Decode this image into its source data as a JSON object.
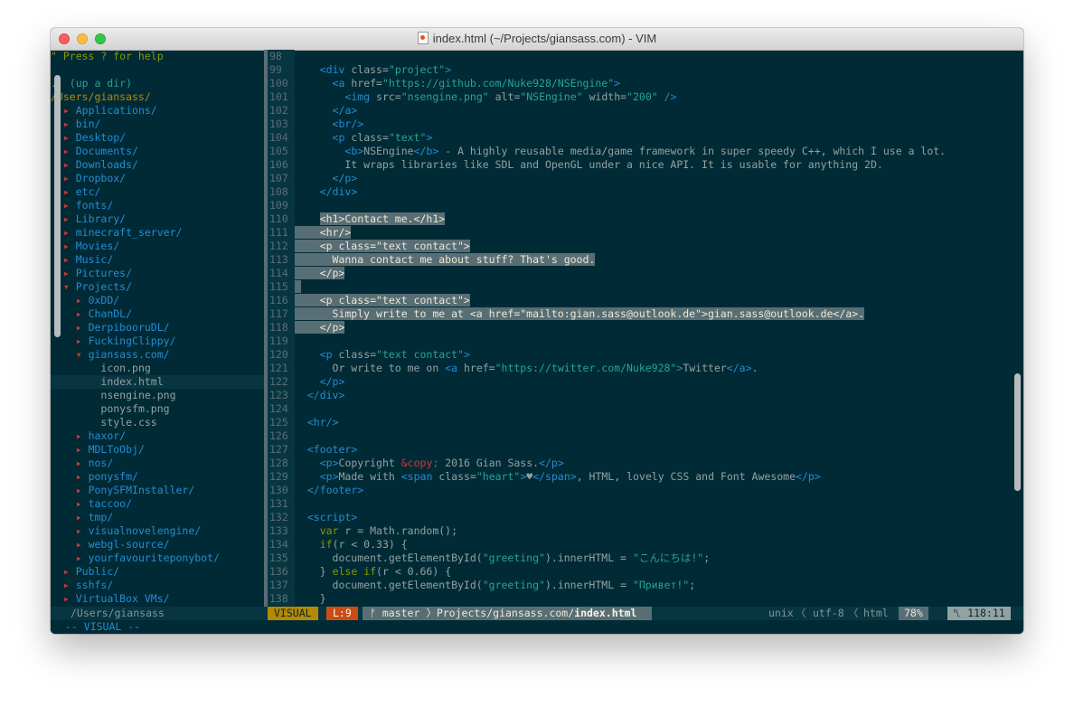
{
  "window": {
    "title": "index.html (~/Projects/giansass.com) - VIM"
  },
  "tree": {
    "help": "\" Press ? for help",
    "up": ".. (up a dir)",
    "root": "/Users/giansass/",
    "items": [
      {
        "depth": 0,
        "type": "dir",
        "open": false,
        "name": "Applications/"
      },
      {
        "depth": 0,
        "type": "dir",
        "open": false,
        "name": "bin/"
      },
      {
        "depth": 0,
        "type": "dir",
        "open": false,
        "name": "Desktop/"
      },
      {
        "depth": 0,
        "type": "dir",
        "open": false,
        "name": "Documents/"
      },
      {
        "depth": 0,
        "type": "dir",
        "open": false,
        "name": "Downloads/"
      },
      {
        "depth": 0,
        "type": "dir",
        "open": false,
        "name": "Dropbox/"
      },
      {
        "depth": 0,
        "type": "dir",
        "open": false,
        "name": "etc/"
      },
      {
        "depth": 0,
        "type": "dir",
        "open": false,
        "name": "fonts/"
      },
      {
        "depth": 0,
        "type": "dir",
        "open": false,
        "name": "Library/"
      },
      {
        "depth": 0,
        "type": "dir",
        "open": false,
        "name": "minecraft_server/"
      },
      {
        "depth": 0,
        "type": "dir",
        "open": false,
        "name": "Movies/"
      },
      {
        "depth": 0,
        "type": "dir",
        "open": false,
        "name": "Music/"
      },
      {
        "depth": 0,
        "type": "dir",
        "open": false,
        "name": "Pictures/"
      },
      {
        "depth": 0,
        "type": "dir",
        "open": true,
        "name": "Projects/"
      },
      {
        "depth": 1,
        "type": "dir",
        "open": false,
        "name": "0xDD/"
      },
      {
        "depth": 1,
        "type": "dir",
        "open": false,
        "name": "ChanDL/"
      },
      {
        "depth": 1,
        "type": "dir",
        "open": false,
        "name": "DerpibooruDL/"
      },
      {
        "depth": 1,
        "type": "dir",
        "open": false,
        "name": "FuckingClippy/"
      },
      {
        "depth": 1,
        "type": "dir",
        "open": true,
        "name": "giansass.com/"
      },
      {
        "depth": 2,
        "type": "file",
        "name": "icon.png"
      },
      {
        "depth": 2,
        "type": "file",
        "name": "index.html",
        "selected": true
      },
      {
        "depth": 2,
        "type": "file",
        "name": "nsengine.png"
      },
      {
        "depth": 2,
        "type": "file",
        "name": "ponysfm.png"
      },
      {
        "depth": 2,
        "type": "file",
        "name": "style.css"
      },
      {
        "depth": 1,
        "type": "dir",
        "open": false,
        "name": "haxor/"
      },
      {
        "depth": 1,
        "type": "dir",
        "open": false,
        "name": "MDLToObj/"
      },
      {
        "depth": 1,
        "type": "dir",
        "open": false,
        "name": "nos/"
      },
      {
        "depth": 1,
        "type": "dir",
        "open": false,
        "name": "ponysfm/"
      },
      {
        "depth": 1,
        "type": "dir",
        "open": false,
        "name": "PonySFMInstaller/"
      },
      {
        "depth": 1,
        "type": "dir",
        "open": false,
        "name": "taccoo/"
      },
      {
        "depth": 1,
        "type": "dir",
        "open": false,
        "name": "tmp/"
      },
      {
        "depth": 1,
        "type": "dir",
        "open": false,
        "name": "visualnovelengine/"
      },
      {
        "depth": 1,
        "type": "dir",
        "open": false,
        "name": "webgl-source/"
      },
      {
        "depth": 1,
        "type": "dir",
        "open": false,
        "name": "yourfavouriteponybot/"
      },
      {
        "depth": 0,
        "type": "dir",
        "open": false,
        "name": "Public/"
      },
      {
        "depth": 0,
        "type": "dir",
        "open": false,
        "name": "sshfs/"
      },
      {
        "depth": 0,
        "type": "dir",
        "open": false,
        "name": "VirtualBox VMs/"
      }
    ]
  },
  "editor": {
    "lines": [
      {
        "n": "98",
        "sel": false,
        "t": ""
      },
      {
        "n": "99",
        "sel": false,
        "t": "    <div class=\"project\">"
      },
      {
        "n": "100",
        "sel": false,
        "t": "      <a href=\"https://github.com/Nuke928/NSEngine\">"
      },
      {
        "n": "101",
        "sel": false,
        "t": "        <img src=\"nsengine.png\" alt=\"NSEngine\" width=\"200\" />"
      },
      {
        "n": "102",
        "sel": false,
        "t": "      </a>"
      },
      {
        "n": "103",
        "sel": false,
        "t": "      <br/>"
      },
      {
        "n": "104",
        "sel": false,
        "t": "      <p class=\"text\">"
      },
      {
        "n": "105",
        "sel": false,
        "t": "        <b>NSEngine</b> - A highly reusable media/game framework in super speedy C++, which I use a lot."
      },
      {
        "n": "106",
        "sel": false,
        "t": "        It wraps libraries like SDL and OpenGL under a nice API. It is usable for anything 2D."
      },
      {
        "n": "107",
        "sel": false,
        "t": "      </p>"
      },
      {
        "n": "108",
        "sel": false,
        "t": "    </div>"
      },
      {
        "n": "109",
        "sel": false,
        "t": ""
      },
      {
        "n": "110",
        "sel": true,
        "pre": "    ",
        "t": "<h1>Contact me.</h1>"
      },
      {
        "n": "111",
        "sel": true,
        "pre": "",
        "t": "    <hr/>"
      },
      {
        "n": "112",
        "sel": true,
        "pre": "",
        "t": "    <p class=\"text contact\">"
      },
      {
        "n": "113",
        "sel": true,
        "pre": "",
        "t": "      Wanna contact me about stuff? That's good."
      },
      {
        "n": "114",
        "sel": true,
        "pre": "",
        "t": "    </p>"
      },
      {
        "n": "115",
        "sel": true,
        "pre": "",
        "t": " "
      },
      {
        "n": "116",
        "sel": true,
        "pre": "",
        "t": "    <p class=\"text contact\">"
      },
      {
        "n": "117",
        "sel": true,
        "pre": "",
        "t": "      Simply write to me at <a href=\"mailto:gian.sass@outlook.de\">gian.sass@outlook.de</a>."
      },
      {
        "n": "118",
        "sel": true,
        "pre": "",
        "t": "    </p>"
      },
      {
        "n": "119",
        "sel": false,
        "t": ""
      },
      {
        "n": "120",
        "sel": false,
        "t": "    <p class=\"text contact\">"
      },
      {
        "n": "121",
        "sel": false,
        "t": "      Or write to me on <a href=\"https://twitter.com/Nuke928\">Twitter</a>."
      },
      {
        "n": "122",
        "sel": false,
        "t": "    </p>"
      },
      {
        "n": "123",
        "sel": false,
        "t": "  </div>"
      },
      {
        "n": "124",
        "sel": false,
        "t": ""
      },
      {
        "n": "125",
        "sel": false,
        "t": "  <hr/>"
      },
      {
        "n": "126",
        "sel": false,
        "t": ""
      },
      {
        "n": "127",
        "sel": false,
        "t": "  <footer>"
      },
      {
        "n": "128",
        "sel": false,
        "t": "    <p>Copyright &copy; 2016 Gian Sass.</p>"
      },
      {
        "n": "129",
        "sel": false,
        "t": "    <p>Made with <span class=\"heart\">♥</span>, HTML, lovely CSS and Font Awesome</p>"
      },
      {
        "n": "130",
        "sel": false,
        "t": "  </footer>"
      },
      {
        "n": "131",
        "sel": false,
        "t": ""
      },
      {
        "n": "132",
        "sel": false,
        "t": "  <script>"
      },
      {
        "n": "133",
        "sel": false,
        "t": "    var r = Math.random();"
      },
      {
        "n": "134",
        "sel": false,
        "t": "    if(r < 0.33) {"
      },
      {
        "n": "135",
        "sel": false,
        "t": "      document.getElementById(\"greeting\").innerHTML = \"こんにちは!\";"
      },
      {
        "n": "136",
        "sel": false,
        "t": "    } else if(r < 0.66) {"
      },
      {
        "n": "137",
        "sel": false,
        "t": "      document.getElementById(\"greeting\").innerHTML = \"Привет!\";"
      },
      {
        "n": "138",
        "sel": false,
        "t": "    }"
      }
    ]
  },
  "status": {
    "tree_path": "/Users/giansass",
    "mode": "VISUAL",
    "line_sel": "L:9",
    "branch_icon": "branch-icon",
    "branch": "master",
    "path_prefix": "Projects/giansass.com/",
    "path_file": "index.html",
    "fileformat": "unix",
    "encoding": "utf-8",
    "filetype": "html",
    "percent": "78%",
    "position": "118:11"
  },
  "cmdline": "-- VISUAL --"
}
